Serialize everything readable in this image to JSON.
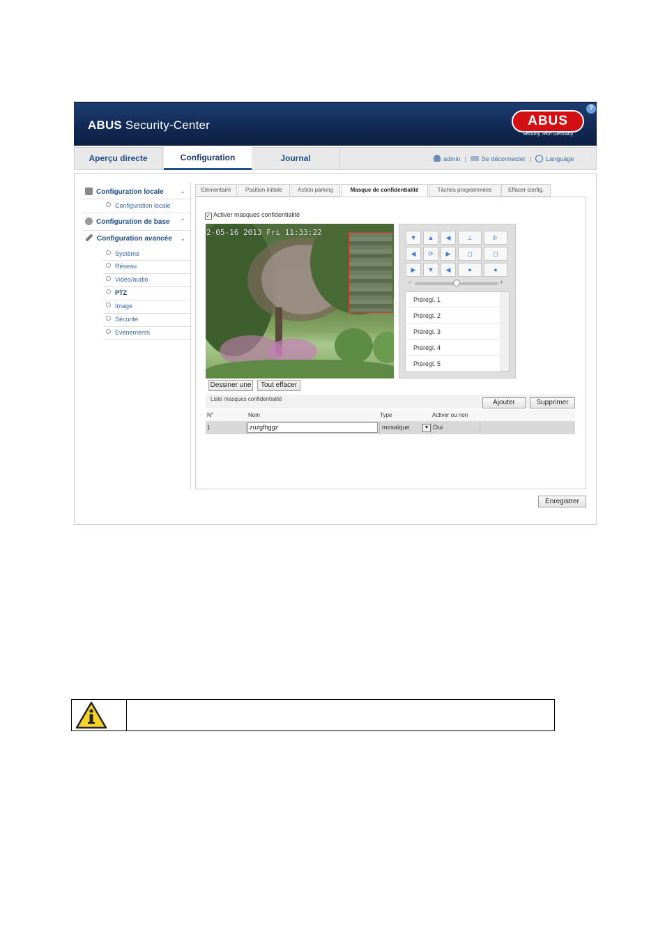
{
  "header": {
    "title_bold": "ABUS",
    "title_rest": " Security-Center",
    "logo_text": "ABUS",
    "logo_sub": "Security Tech Germany",
    "help": "?"
  },
  "nav": {
    "tabs": [
      "Aperçu directe",
      "Configuration",
      "Journal"
    ],
    "active": "Configuration",
    "user": "admin",
    "logout": "Se déconnecter",
    "language": "Language"
  },
  "sidebar": {
    "local": {
      "label": "Configuration locale",
      "items": [
        "Configuration locale"
      ]
    },
    "base": {
      "label": "Configuration de base"
    },
    "advanced": {
      "label": "Configuration avancée",
      "items": [
        "Système",
        "Réseau",
        "Vidéo/audio",
        "PTZ",
        "Image",
        "Sécurité",
        "Evènements"
      ],
      "active": "PTZ"
    }
  },
  "subtabs": [
    "Elémentaire",
    "Position initiale",
    "Action parking",
    "Masque de confidentialité",
    "Tâches programmées",
    "Effacer config."
  ],
  "active_subtab": "Masque de confidentialité",
  "enable_masks": {
    "label": "Activer masques confidentialité",
    "checked": true,
    "mark": "✓"
  },
  "video": {
    "osd": "2-05-16 2013 Fri 11:33:22"
  },
  "ptz": {
    "arrows": [
      "▼",
      "▲",
      "◀",
      "◀",
      "⟳",
      "▶",
      "▶",
      "▼",
      "◀"
    ],
    "zoom": [
      "⊥",
      "⊪",
      "◻",
      "◻",
      "●",
      "●"
    ],
    "slider_minus": "−",
    "slider_plus": "+",
    "slider_level": 0.5,
    "presets": [
      "Prérégl. 1",
      "Prérégl. 2",
      "Prérégl. 3",
      "Prérégl. 4",
      "Prérégl. 5"
    ]
  },
  "buttons": {
    "draw": "Dessiner une",
    "clear": "Tout effacer",
    "add": "Ajouter",
    "delete": "Supprimer",
    "save": "Enregistrer"
  },
  "mask_list": {
    "title": "Liste masques confidentialité",
    "columns": [
      "N°",
      "Nom",
      "Type",
      "Activer ou non"
    ],
    "rows": [
      {
        "no": "1",
        "name": "zuzgfhggz",
        "type": "mosaïque",
        "dropdown": "▼",
        "enabled": "Oui"
      }
    ]
  },
  "warning": {
    "icon": "warning-info-icon",
    "text": ""
  }
}
